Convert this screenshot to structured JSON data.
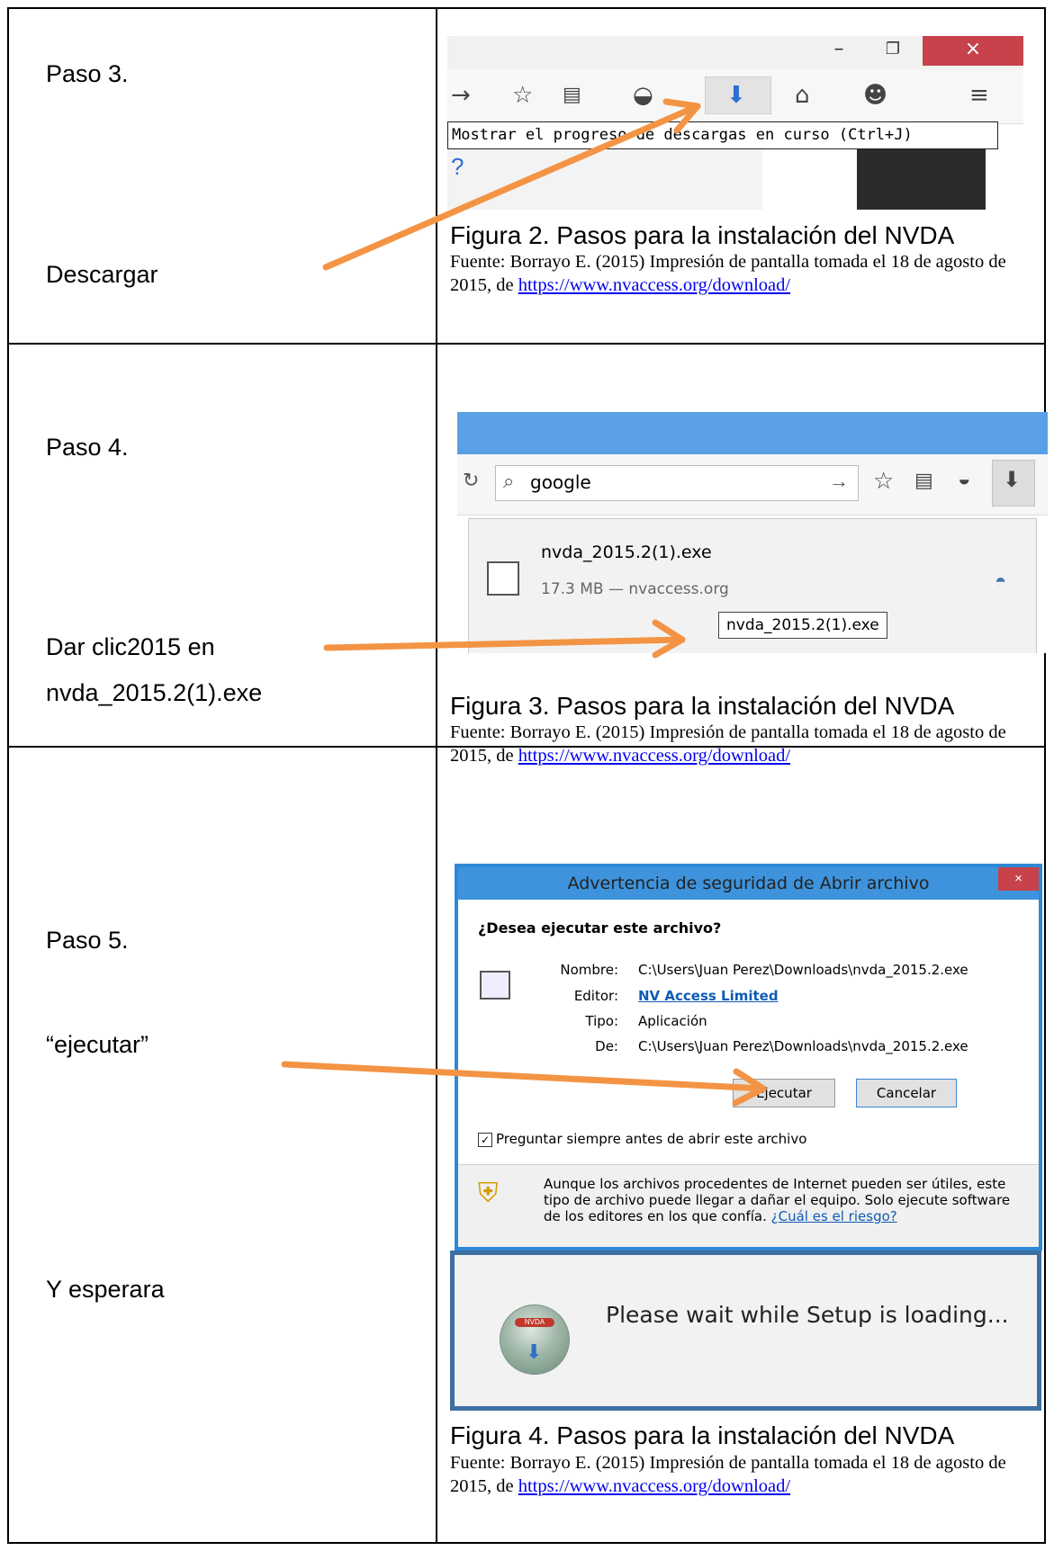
{
  "rows": [
    {
      "step_label": "Paso 3.",
      "step_action": "Descargar",
      "caption_title": "Figura 2. Pasos para la instalación del NVDA",
      "caption_source": "Fuente: Borrayo E. (2015) Impresión de pantalla tomada el 18 de agosto de 2015, de ",
      "caption_link": "https://www.nvaccess.org/download/"
    },
    {
      "step_label": "Paso 4.",
      "step_action_1": "Dar clic2015 en",
      "step_action_2": "nvda_2015.2(1).exe",
      "caption_title": "Figura 3. Pasos para la instalación del NVDA",
      "caption_source": "Fuente: Borrayo E. (2015) Impresión de pantalla tomada el 18 de agosto de 2015, de ",
      "caption_link": "https://www.nvaccess.org/download/"
    },
    {
      "step_label": "Paso 5.",
      "step_action_1": "“ejecutar”",
      "step_action_2": "Y esperara",
      "caption_title": "Figura 4. Pasos para la instalación del NVDA",
      "caption_source": "Fuente: Borrayo E. (2015) Impresión de pantalla tomada el 18 de agosto de 2015, de ",
      "caption_link": "https://www.nvaccess.org/download/"
    }
  ],
  "screenshot1": {
    "tooltip": "Mostrar el progreso de descargas en curso (Ctrl+J)",
    "question_mark": "?"
  },
  "screenshot2": {
    "search_text": "google",
    "file_name": "nvda_2015.2(1).exe",
    "file_meta": "17.3 MB — nvaccess.org",
    "tooltip": "nvda_2015.2(1).exe"
  },
  "screenshot3": {
    "title": "Advertencia de seguridad de Abrir archivo",
    "close": "×",
    "question": "¿Desea ejecutar este archivo?",
    "name_label": "Nombre:",
    "name_value": "C:\\Users\\Juan Perez\\Downloads\\nvda_2015.2.exe",
    "publisher_label": "Editor:",
    "publisher_value": "NV Access Limited",
    "type_label": "Tipo:",
    "type_value": "Aplicación",
    "from_label": "De:",
    "from_value": "C:\\Users\\Juan Perez\\Downloads\\nvda_2015.2.exe",
    "run_button": "Ejecutar",
    "cancel_button": "Cancelar",
    "checkbox_label": "Preguntar siempre antes de abrir este archivo",
    "warning_text": "Aunque los archivos procedentes de Internet pueden ser útiles, este tipo de archivo puede llegar a dañar el equipo. Solo ejecute software de los editores en los que confía. ",
    "warning_link": "¿Cuál es el riesgo?"
  },
  "screenshot4": {
    "logo_tag": "NVDA",
    "message": "Please wait while Setup is loading..."
  },
  "colors": {
    "arrow": "#f39445",
    "link": "#0000ee"
  }
}
